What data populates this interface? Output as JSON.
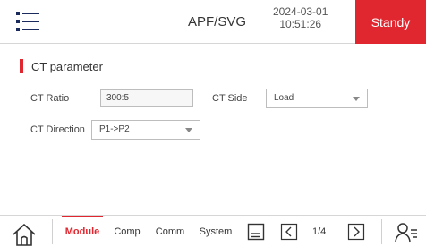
{
  "header": {
    "title": "APF/SVG",
    "date": "2024-03-01",
    "time": "10:51:26",
    "status_label": "Standy",
    "accent_color": "#e0262e"
  },
  "section": {
    "title": "CT parameter"
  },
  "fields": {
    "ct_ratio_label": "CT Ratio",
    "ct_ratio_value": "300:5",
    "ct_side_label": "CT Side",
    "ct_side_value": "Load",
    "ct_direction_label": "CT Direction",
    "ct_direction_value": "P1->P2"
  },
  "footer": {
    "tabs": [
      "Module",
      "Comp",
      "Comm",
      "System"
    ],
    "active_tab": "Module",
    "page_indicator": "1/4",
    "icons": [
      "home-icon",
      "save-icon",
      "prev-page-icon",
      "next-page-icon",
      "user-settings-icon"
    ]
  }
}
